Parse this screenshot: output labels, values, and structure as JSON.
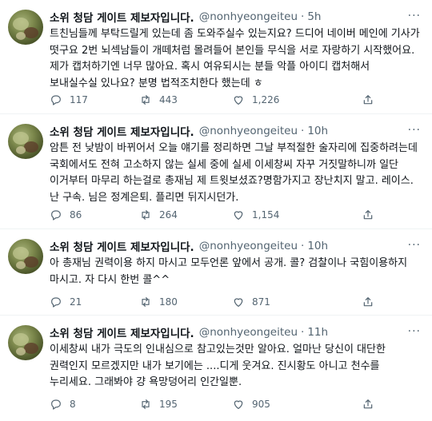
{
  "tweets": [
    {
      "name": "소위 청담 게이트 제보자입니다.",
      "handle": "@nonhyeongeiteu",
      "dot": "·",
      "time": "5h",
      "text": "트친님들께 부탁드릴게 있는데 좀 도와주실수 있는지요? 드디어 네이버 메인에 기사가 떳구요 2번 뇌섹남들이 개떼처럼 몰려들어 본인들 무식을 서로 자랑하기 시작했어요. 제가 캡처하기엔 너무 많아요. 혹시 여유되시는 분들 악플 아이디 캡처해서 보내실수실 있나요? 분명 법적조치한다 했는데 ㅎ",
      "replies": "117",
      "retweets": "443",
      "likes": "1,226"
    },
    {
      "name": "소위 청담 게이트 제보자입니다.",
      "handle": "@nonhyeongeiteu",
      "dot": "·",
      "time": "10h",
      "text": "암튼 전 낮밤이 바뀌어서 오늘 얘기를 정리하면 그날 부적절한 술자리에 집중하려는데 국회에서도 전혀 고소하지 않는 실세 중에 실세 이세창씨 자꾸 거짓말하니까 일단 이거부터 마무리 하는걸로 총재님 제 트윗보셨죠?명함가지고 장난치지 말고. 레이스. 난 구속. 님은 정계은퇴. 플리면 뒤지시던가.",
      "replies": "86",
      "retweets": "264",
      "likes": "1,154"
    },
    {
      "name": "소위 청담 게이트 제보자입니다.",
      "handle": "@nonhyeongeiteu",
      "dot": "·",
      "time": "10h",
      "text": "아 총재님 권력이용 하지 마시고 모두언론 앞에서 공개. 콜? 검찰이나 국힘이용하지 마시고. 자 다시 한번 콜^^",
      "replies": "21",
      "retweets": "180",
      "likes": "871"
    },
    {
      "name": "소위 청담 게이트 제보자입니다.",
      "handle": "@nonhyeongeiteu",
      "dot": "·",
      "time": "11h",
      "text": "이세창씨 내가 극도의 인내심으로 참고있는것만 알아요. 얼마난 당신이 대단한 권력인지 모르겠지만 내가 보기에는 ....디게 웃겨요. 진시황도 아니고 천수를 누리세요. 그래봐야 걍 욕망덩어리 인간일뿐.",
      "replies": "8",
      "retweets": "195",
      "likes": "905"
    }
  ],
  "more_label": "···",
  "colors": {
    "text": "#0f1419",
    "secondary": "#536471",
    "divider": "#eff3f4"
  },
  "icons": [
    "reply-icon",
    "retweet-icon",
    "like-icon",
    "share-icon",
    "more-icon"
  ]
}
